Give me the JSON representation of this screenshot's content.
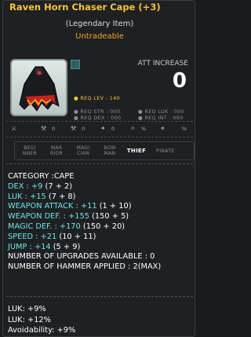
{
  "item": {
    "name": "Raven Horn Chaser Cape (+3)",
    "rarity": "(Legendary Item)",
    "trade_status": "Untradeable",
    "att_label": "ATT INCREASE",
    "att_value": "0"
  },
  "requirements": {
    "lev": "● REQ LEV : 140",
    "str": "● REQ STR : 000",
    "dex": "● REQ DEX : 000",
    "luk": "● REQ LUK : 000",
    "int": "● REQ INT : 000"
  },
  "icon_values": [
    "0",
    "0",
    "0",
    "%",
    "%"
  ],
  "jobs": [
    {
      "label": "BEGI\nNNER",
      "active": false
    },
    {
      "label": "WAR\nRIOR",
      "active": false
    },
    {
      "label": "MAGI\nCIAN",
      "active": false
    },
    {
      "label": "BOW\nMAN",
      "active": false
    },
    {
      "label": "THIEF",
      "active": true
    },
    {
      "label": "PIRATE",
      "active": false
    }
  ],
  "stats": {
    "category": "CATEGORY :CAPE",
    "dex": {
      "label": "DEX : +9",
      "detail": " (7 + 2)"
    },
    "luk": {
      "label": "LUK : +15",
      "detail": " (7 + 8)"
    },
    "weapon_attack": {
      "label": "WEAPON ATTACK : +11",
      "detail": " (1 + 10)"
    },
    "weapon_def": {
      "label": "WEAPON DEF. : +155",
      "detail": " (150 + 5)"
    },
    "magic_def": {
      "label": "MAGIC DEF. : +170",
      "detail": " (150 + 20)"
    },
    "speed": {
      "label": "SPEED : +21",
      "detail": " (10 + 11)"
    },
    "jump": {
      "label": "JUMP : +14",
      "detail": " (5 + 9)"
    },
    "upgrades": "NUMBER OF UPGRADES AVAILABLE : 0",
    "hammer": "NUMBER OF HAMMER APPLIED : 2(MAX)"
  },
  "potential": [
    "LUK: +9%",
    "LUK: +12%",
    "Avoidability: +9%"
  ],
  "colors": {
    "title": "#f7c43a",
    "untradeable": "#f5a623",
    "stat": "#6fe3e6"
  }
}
